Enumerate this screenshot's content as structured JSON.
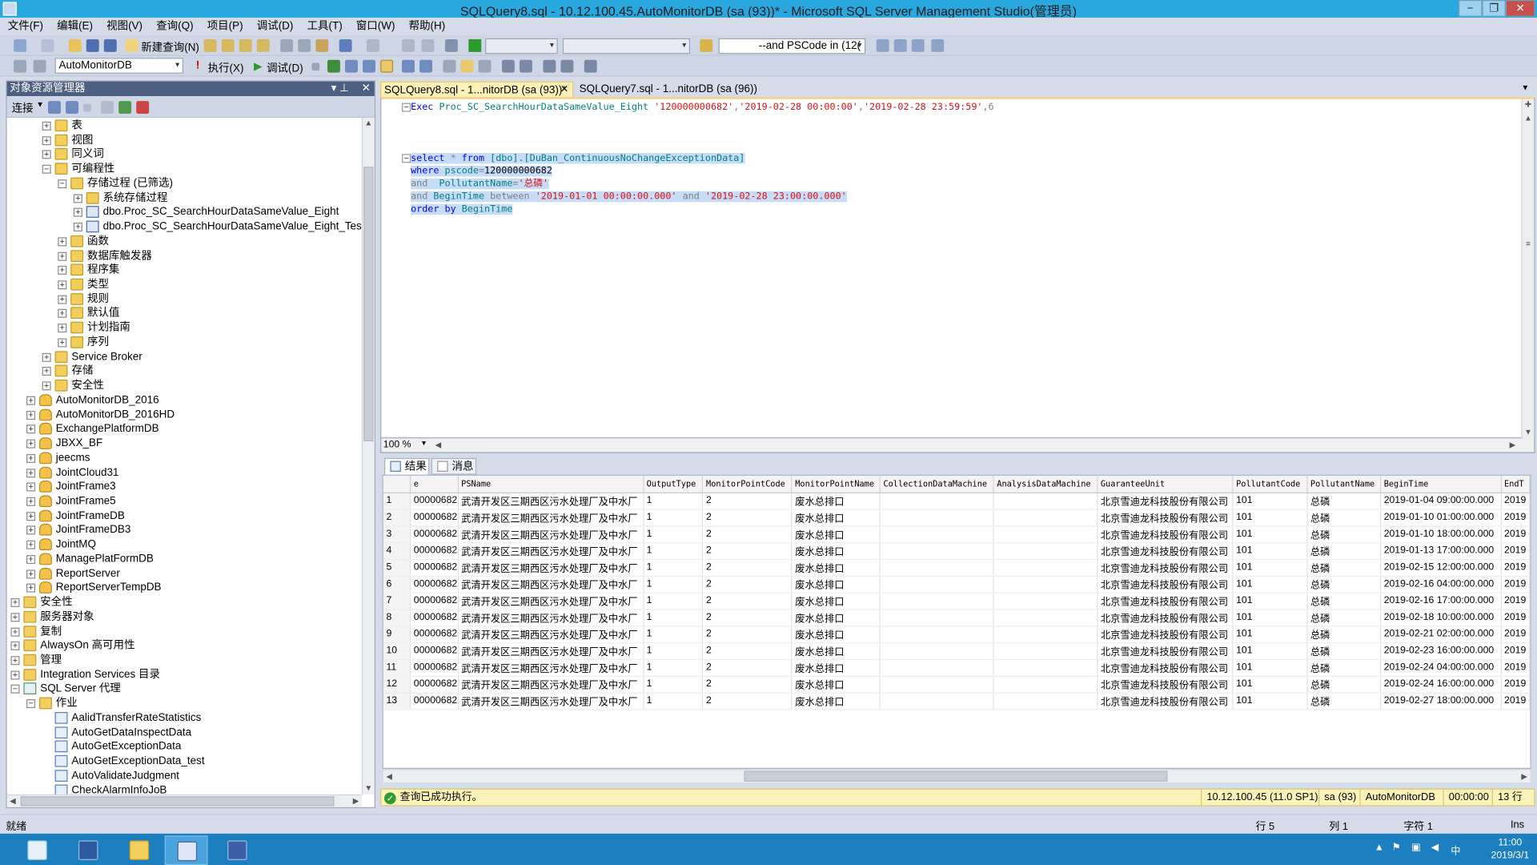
{
  "window": {
    "title": "SQLQuery8.sql - 10.12.100.45.AutoMonitorDB (sa (93))* - Microsoft SQL Server Management Studio(管理员)",
    "minimize": "−",
    "restore": "❐",
    "close": "✕"
  },
  "menu": [
    "文件(F)",
    "编辑(E)",
    "视图(V)",
    "查询(Q)",
    "项目(P)",
    "调试(D)",
    "工具(T)",
    "窗口(W)",
    "帮助(H)"
  ],
  "toolbar1": {
    "new_query": "新建查询(N)",
    "search_text": "--and PSCode in (12("
  },
  "toolbar2": {
    "database": "AutoMonitorDB",
    "execute": "执行(X)",
    "debug": "调试(D)"
  },
  "object_explorer": {
    "title": "对象资源管理器",
    "connect": "连接",
    "nodes": [
      {
        "label": "表",
        "indent": 3,
        "expander": "+",
        "icon": "folder"
      },
      {
        "label": "视图",
        "indent": 3,
        "expander": "+",
        "icon": "folder"
      },
      {
        "label": "同义词",
        "indent": 3,
        "expander": "+",
        "icon": "folder"
      },
      {
        "label": "可编程性",
        "indent": 3,
        "expander": "−",
        "icon": "folder"
      },
      {
        "label": "存储过程 (已筛选)",
        "indent": 4,
        "expander": "−",
        "icon": "folder"
      },
      {
        "label": "系统存储过程",
        "indent": 5,
        "expander": "+",
        "icon": "folder"
      },
      {
        "label": "dbo.Proc_SC_SearchHourDataSameValue_Eight",
        "indent": 5,
        "expander": "+",
        "icon": "proc"
      },
      {
        "label": "dbo.Proc_SC_SearchHourDataSameValue_Eight_Test",
        "indent": 5,
        "expander": "+",
        "icon": "proc"
      },
      {
        "label": "函数",
        "indent": 4,
        "expander": "+",
        "icon": "folder"
      },
      {
        "label": "数据库触发器",
        "indent": 4,
        "expander": "+",
        "icon": "folder"
      },
      {
        "label": "程序集",
        "indent": 4,
        "expander": "+",
        "icon": "folder"
      },
      {
        "label": "类型",
        "indent": 4,
        "expander": "+",
        "icon": "folder"
      },
      {
        "label": "规则",
        "indent": 4,
        "expander": "+",
        "icon": "folder"
      },
      {
        "label": "默认值",
        "indent": 4,
        "expander": "+",
        "icon": "folder"
      },
      {
        "label": "计划指南",
        "indent": 4,
        "expander": "+",
        "icon": "folder"
      },
      {
        "label": "序列",
        "indent": 4,
        "expander": "+",
        "icon": "folder"
      },
      {
        "label": "Service Broker",
        "indent": 3,
        "expander": "+",
        "icon": "folder"
      },
      {
        "label": "存储",
        "indent": 3,
        "expander": "+",
        "icon": "folder"
      },
      {
        "label": "安全性",
        "indent": 3,
        "expander": "+",
        "icon": "folder"
      },
      {
        "label": "AutoMonitorDB_2016",
        "indent": 2,
        "expander": "+",
        "icon": "db"
      },
      {
        "label": "AutoMonitorDB_2016HD",
        "indent": 2,
        "expander": "+",
        "icon": "db"
      },
      {
        "label": "ExchangePlatformDB",
        "indent": 2,
        "expander": "+",
        "icon": "db"
      },
      {
        "label": "JBXX_BF",
        "indent": 2,
        "expander": "+",
        "icon": "db"
      },
      {
        "label": "jeecms",
        "indent": 2,
        "expander": "+",
        "icon": "db"
      },
      {
        "label": "JointCloud31",
        "indent": 2,
        "expander": "+",
        "icon": "db"
      },
      {
        "label": "JointFrame3",
        "indent": 2,
        "expander": "+",
        "icon": "db"
      },
      {
        "label": "JointFrame5",
        "indent": 2,
        "expander": "+",
        "icon": "db"
      },
      {
        "label": "JointFrameDB",
        "indent": 2,
        "expander": "+",
        "icon": "db"
      },
      {
        "label": "JointFrameDB3",
        "indent": 2,
        "expander": "+",
        "icon": "db"
      },
      {
        "label": "JointMQ",
        "indent": 2,
        "expander": "+",
        "icon": "db"
      },
      {
        "label": "ManagePlatFormDB",
        "indent": 2,
        "expander": "+",
        "icon": "db"
      },
      {
        "label": "ReportServer",
        "indent": 2,
        "expander": "+",
        "icon": "db"
      },
      {
        "label": "ReportServerTempDB",
        "indent": 2,
        "expander": "+",
        "icon": "db"
      },
      {
        "label": "安全性",
        "indent": 1,
        "expander": "+",
        "icon": "folder"
      },
      {
        "label": "服务器对象",
        "indent": 1,
        "expander": "+",
        "icon": "folder"
      },
      {
        "label": "复制",
        "indent": 1,
        "expander": "+",
        "icon": "folder"
      },
      {
        "label": "AlwaysOn 高可用性",
        "indent": 1,
        "expander": "+",
        "icon": "folder"
      },
      {
        "label": "管理",
        "indent": 1,
        "expander": "+",
        "icon": "folder"
      },
      {
        "label": "Integration Services 目录",
        "indent": 1,
        "expander": "+",
        "icon": "folder"
      },
      {
        "label": "SQL Server 代理",
        "indent": 1,
        "expander": "−",
        "icon": "agent"
      },
      {
        "label": "作业",
        "indent": 2,
        "expander": "−",
        "icon": "folder"
      },
      {
        "label": "AalidTransferRateStatistics",
        "indent": 3,
        "expander": "",
        "icon": "job"
      },
      {
        "label": "AutoGetDataInspectData",
        "indent": 3,
        "expander": "",
        "icon": "job"
      },
      {
        "label": "AutoGetExceptionData",
        "indent": 3,
        "expander": "",
        "icon": "job"
      },
      {
        "label": "AutoGetExceptionData_test",
        "indent": 3,
        "expander": "",
        "icon": "job"
      },
      {
        "label": "AutoValidateJudgment",
        "indent": 3,
        "expander": "",
        "icon": "job"
      },
      {
        "label": "CheckAlarmInfoJoB",
        "indent": 3,
        "expander": "",
        "icon": "job"
      }
    ]
  },
  "tabs": [
    {
      "label": "SQLQuery8.sql - 1...nitorDB (sa (93))*",
      "close": "✕"
    },
    {
      "label": "SQLQuery7.sql - 1...nitorDB (sa (96))"
    }
  ],
  "editor": {
    "exec_kw": "Exec",
    "exec_proc": "Proc_SC_SearchHourDataSameValue_Eight",
    "exec_a1": "'120000000682'",
    "exec_a2": "'2019-02-28 00:00:00'",
    "exec_a3": "'2019-02-28 23:59:59'",
    "exec_a4": ",6",
    "comma": ",",
    "l1_select": "select",
    "l1_star": "*",
    "l1_from": "from",
    "l1_tbl": "[dbo].[DuBan_ContinuousNoChangeExceptionData]",
    "l2_where": "where",
    "l2_col": "pscode",
    "l2_eq": "=",
    "l2_val": "120000000682",
    "l3_and": "and",
    "l3_col": "PollutantName",
    "l3_eq": "=",
    "l3_str": "'总磷'",
    "l4_and": "and",
    "l4_col": "BeginTime",
    "l4_between": "between",
    "l4_s1": "'2019-01-01 00:00:00.000'",
    "l4_and2": "and",
    "l4_s2": "'2019-02-28 23:00:00.000'",
    "l5_order": "order by",
    "l5_col": "BeginTime",
    "zoom": "100 %"
  },
  "results": {
    "tab_results": "结果",
    "tab_messages": "消息",
    "columns": [
      "e",
      "PSName",
      "OutputType",
      "MonitorPointCode",
      "MonitorPointName",
      "CollectionDataMachine",
      "AnalysisDataMachine",
      "GuaranteeUnit",
      "PollutantCode",
      "PollutantName",
      "BeginTime",
      "EndT"
    ],
    "rows": [
      [
        "1",
        "00000682",
        "武清开发区三期西区污水处理厂及中水厂",
        "1",
        "2",
        "废水总排口",
        "",
        "",
        "北京雪迪龙科技股份有限公司",
        "101",
        "总磷",
        "2019-01-04 09:00:00.000",
        "2019"
      ],
      [
        "2",
        "00000682",
        "武清开发区三期西区污水处理厂及中水厂",
        "1",
        "2",
        "废水总排口",
        "",
        "",
        "北京雪迪龙科技股份有限公司",
        "101",
        "总磷",
        "2019-01-10 01:00:00.000",
        "2019"
      ],
      [
        "3",
        "00000682",
        "武清开发区三期西区污水处理厂及中水厂",
        "1",
        "2",
        "废水总排口",
        "",
        "",
        "北京雪迪龙科技股份有限公司",
        "101",
        "总磷",
        "2019-01-10 18:00:00.000",
        "2019"
      ],
      [
        "4",
        "00000682",
        "武清开发区三期西区污水处理厂及中水厂",
        "1",
        "2",
        "废水总排口",
        "",
        "",
        "北京雪迪龙科技股份有限公司",
        "101",
        "总磷",
        "2019-01-13 17:00:00.000",
        "2019"
      ],
      [
        "5",
        "00000682",
        "武清开发区三期西区污水处理厂及中水厂",
        "1",
        "2",
        "废水总排口",
        "",
        "",
        "北京雪迪龙科技股份有限公司",
        "101",
        "总磷",
        "2019-02-15 12:00:00.000",
        "2019"
      ],
      [
        "6",
        "00000682",
        "武清开发区三期西区污水处理厂及中水厂",
        "1",
        "2",
        "废水总排口",
        "",
        "",
        "北京雪迪龙科技股份有限公司",
        "101",
        "总磷",
        "2019-02-16 04:00:00.000",
        "2019"
      ],
      [
        "7",
        "00000682",
        "武清开发区三期西区污水处理厂及中水厂",
        "1",
        "2",
        "废水总排口",
        "",
        "",
        "北京雪迪龙科技股份有限公司",
        "101",
        "总磷",
        "2019-02-16 17:00:00.000",
        "2019"
      ],
      [
        "8",
        "00000682",
        "武清开发区三期西区污水处理厂及中水厂",
        "1",
        "2",
        "废水总排口",
        "",
        "",
        "北京雪迪龙科技股份有限公司",
        "101",
        "总磷",
        "2019-02-18 10:00:00.000",
        "2019"
      ],
      [
        "9",
        "00000682",
        "武清开发区三期西区污水处理厂及中水厂",
        "1",
        "2",
        "废水总排口",
        "",
        "",
        "北京雪迪龙科技股份有限公司",
        "101",
        "总磷",
        "2019-02-21 02:00:00.000",
        "2019"
      ],
      [
        "10",
        "00000682",
        "武清开发区三期西区污水处理厂及中水厂",
        "1",
        "2",
        "废水总排口",
        "",
        "",
        "北京雪迪龙科技股份有限公司",
        "101",
        "总磷",
        "2019-02-23 16:00:00.000",
        "2019"
      ],
      [
        "11",
        "00000682",
        "武清开发区三期西区污水处理厂及中水厂",
        "1",
        "2",
        "废水总排口",
        "",
        "",
        "北京雪迪龙科技股份有限公司",
        "101",
        "总磷",
        "2019-02-24 04:00:00.000",
        "2019"
      ],
      [
        "12",
        "00000682",
        "武清开发区三期西区污水处理厂及中水厂",
        "1",
        "2",
        "废水总排口",
        "",
        "",
        "北京雪迪龙科技股份有限公司",
        "101",
        "总磷",
        "2019-02-24 16:00:00.000",
        "2019"
      ],
      [
        "13",
        "00000682",
        "武清开发区三期西区污水处理厂及中水厂",
        "1",
        "2",
        "废水总排口",
        "",
        "",
        "北京雪迪龙科技股份有限公司",
        "101",
        "总磷",
        "2019-02-27 18:00:00.000",
        "2019"
      ]
    ]
  },
  "query_status": {
    "message": "查询已成功执行。",
    "server": "10.12.100.45 (11.0 SP1)",
    "user": "sa (93)",
    "database": "AutoMonitorDB",
    "elapsed": "00:00:00",
    "rows": "13 行"
  },
  "statusbar": {
    "ready": "就绪",
    "line": "行 5",
    "col": "列 1",
    "char": "字符 1",
    "mode": "Ins"
  },
  "taskbar": {
    "time": "11:00",
    "date": "2019/3/1"
  },
  "colors": {
    "title": "#29a8e0",
    "taskbar": "#1c7fbf",
    "active_tab": "#fdf1b8",
    "selection": "#c7dcf7",
    "status": "#fbf3b8"
  }
}
